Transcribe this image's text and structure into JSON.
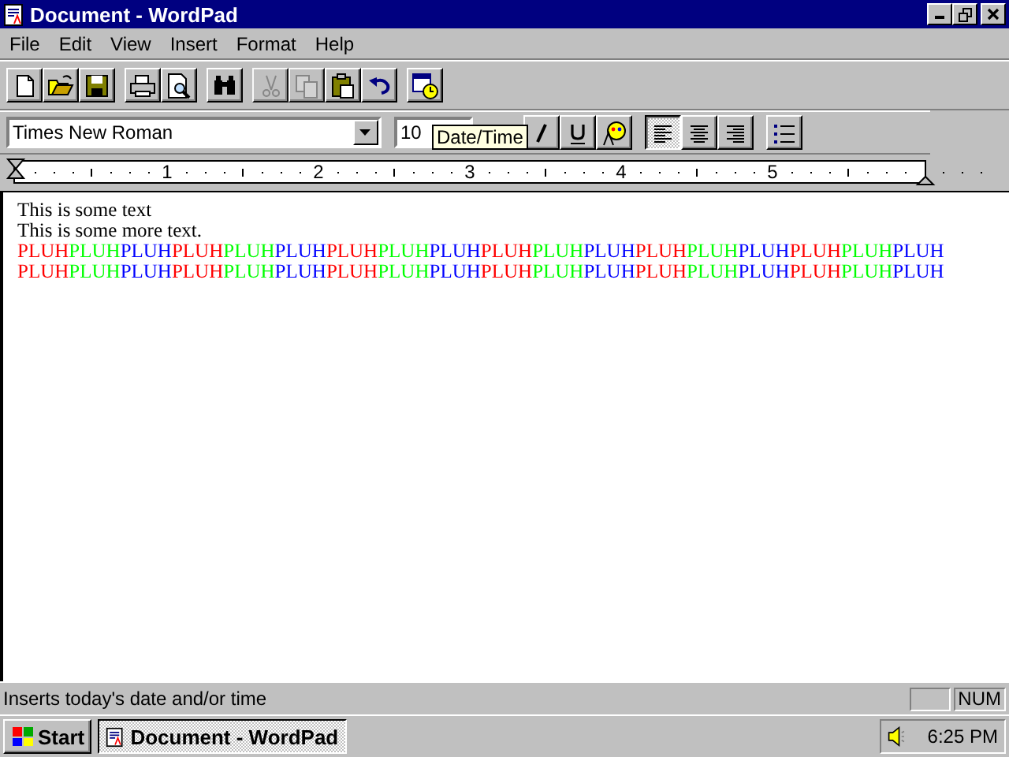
{
  "window": {
    "title": "Document - WordPad"
  },
  "menu": [
    "File",
    "Edit",
    "View",
    "Insert",
    "Format",
    "Help"
  ],
  "toolbar": {
    "groups": [
      [
        {
          "kind": "new",
          "disabled": false
        },
        {
          "kind": "open",
          "disabled": false
        },
        {
          "kind": "save",
          "disabled": false
        }
      ],
      [
        {
          "kind": "print",
          "disabled": false
        },
        {
          "kind": "preview",
          "disabled": false
        }
      ],
      [
        {
          "kind": "find",
          "disabled": false
        }
      ],
      [
        {
          "kind": "cut",
          "disabled": true
        },
        {
          "kind": "copy",
          "disabled": true
        },
        {
          "kind": "paste",
          "disabled": false
        },
        {
          "kind": "undo",
          "disabled": false
        }
      ],
      [
        {
          "kind": "datetime",
          "disabled": false
        }
      ]
    ]
  },
  "format_bar": {
    "font": "Times New Roman",
    "size": "10",
    "tooltip": "Date/Time",
    "buttons": [
      {
        "kind": "italic",
        "selected": false
      },
      {
        "kind": "underline",
        "selected": false
      },
      {
        "kind": "color",
        "selected": false
      }
    ],
    "align": [
      {
        "kind": "left",
        "selected": true
      },
      {
        "kind": "center",
        "selected": false
      },
      {
        "kind": "right",
        "selected": false
      }
    ],
    "bullets": {
      "selected": false
    }
  },
  "ruler": {
    "numbers": [
      "1",
      "2",
      "3",
      "4",
      "5"
    ]
  },
  "document": {
    "lines": [
      "This is some text",
      "This is some more text."
    ],
    "colored_lines": [
      {
        "runs": [
          {
            "text": "PLUH",
            "color": "#ff0000"
          },
          {
            "text": "PLUH",
            "color": "#00ff00"
          },
          {
            "text": "PLUH",
            "color": "#0000ff"
          },
          {
            "text": "PLUH",
            "color": "#ff0000"
          },
          {
            "text": "PLUH",
            "color": "#00ff00"
          },
          {
            "text": "PLUH",
            "color": "#0000ff"
          },
          {
            "text": "PLUH",
            "color": "#ff0000"
          },
          {
            "text": "PLUH",
            "color": "#00ff00"
          },
          {
            "text": "PLUH",
            "color": "#0000ff"
          },
          {
            "text": "PLUH",
            "color": "#ff0000"
          },
          {
            "text": "PLUH",
            "color": "#00ff00"
          },
          {
            "text": "PLUH",
            "color": "#0000ff"
          },
          {
            "text": "PLUH",
            "color": "#ff0000"
          },
          {
            "text": "PLUH",
            "color": "#00ff00"
          },
          {
            "text": "PLUH",
            "color": "#0000ff"
          },
          {
            "text": "PLUH",
            "color": "#ff0000"
          },
          {
            "text": "PLUH",
            "color": "#00ff00"
          },
          {
            "text": "PLUH",
            "color": "#0000ff"
          }
        ]
      },
      {
        "runs": [
          {
            "text": "PLUH",
            "color": "#ff0000"
          },
          {
            "text": "PLUH",
            "color": "#00ff00"
          },
          {
            "text": "PLUH",
            "color": "#0000ff"
          },
          {
            "text": "PLUH",
            "color": "#ff0000"
          },
          {
            "text": "PLUH",
            "color": "#00ff00"
          },
          {
            "text": "PLUH",
            "color": "#0000ff"
          },
          {
            "text": "PLUH",
            "color": "#ff0000"
          },
          {
            "text": "PLUH",
            "color": "#00ff00"
          },
          {
            "text": "PLUH",
            "color": "#0000ff"
          },
          {
            "text": "PLUH",
            "color": "#ff0000"
          },
          {
            "text": "PLUH",
            "color": "#00ff00"
          },
          {
            "text": "PLUH",
            "color": "#0000ff"
          },
          {
            "text": "PLUH",
            "color": "#ff0000"
          },
          {
            "text": "PLUH",
            "color": "#00ff00"
          },
          {
            "text": "PLUH",
            "color": "#0000ff"
          },
          {
            "text": "PLUH",
            "color": "#ff0000"
          },
          {
            "text": "PLUH",
            "color": "#00ff00"
          },
          {
            "text": "PLUH",
            "color": "#0000ff"
          }
        ]
      }
    ]
  },
  "status_bar": {
    "text": "Inserts today's date and/or time",
    "indicator": "NUM"
  },
  "taskbar": {
    "start": "Start",
    "tasks": [
      {
        "title": "Document - WordPad",
        "selected": true
      }
    ],
    "clock": "6:25 PM"
  }
}
